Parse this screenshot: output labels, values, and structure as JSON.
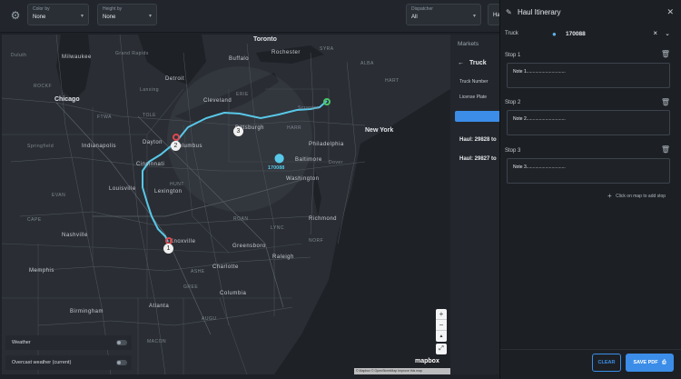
{
  "toolbar": {
    "color_by": {
      "label": "Color by",
      "value": "None"
    },
    "height_by": {
      "label": "Height by",
      "value": "None"
    },
    "dispatcher": {
      "label": "Dispatcher",
      "value": "All"
    },
    "extra_value": "Ha"
  },
  "map": {
    "labels": {
      "toronto": "Toronto",
      "chicago": "Chicago",
      "new_york": "New York",
      "milwaukee": "Milwaukee",
      "grand_rapids": "Grand Rapids",
      "detroit": "Detroit",
      "cleveland": "Cleveland",
      "pittsburgh": "Pittsburgh",
      "harrisburg": "HARR",
      "philadelphia": "Philadelphia",
      "baltimore": "Baltimore",
      "washington": "Washington",
      "columbus": "Columbus",
      "indianapolis": "Indianapolis",
      "cincinnati": "Cincinnati",
      "louisville": "Louisville",
      "lexington": "Lexington",
      "nashville": "Nashville",
      "knoxville": "Knoxville",
      "charlotte": "Charlotte",
      "greensboro": "Greensboro",
      "raleigh": "Raleigh",
      "richmond": "Richmond",
      "norfolk": "NORF",
      "atlanta": "Atlanta",
      "birmingham": "Birmingham",
      "memphis": "Memphis",
      "columbia": "Columbia",
      "rochester": "Rochester",
      "buffalo": "Buffalo",
      "syracuse": "SYRA",
      "albany": "ALBA",
      "erie": "ERIE",
      "toledo": "TOLE",
      "fort_wayne": "FTWA",
      "dayton": "Dayton",
      "springfield": "Springfield",
      "evansville": "EVAN",
      "cape": "CAPE",
      "hunt": "HUNT",
      "roan": "ROAN",
      "duluth": "Duluth",
      "lansing": "Lansing",
      "rockford": "ROCKF",
      "dover": "Dover",
      "scranton": "Scranton",
      "hartford": "HART",
      "lynchburg": "LYNC",
      "asheville": "ASHE",
      "greenville": "GREE",
      "augusta": "AUGU",
      "macon": "MACON"
    },
    "truck_marker_label": "170088",
    "stop_numbers": [
      "1",
      "2",
      "3"
    ],
    "mapbox": "mapbox",
    "attribution": "© Mapbox © OpenStreetMap Improve this map",
    "zoom_in": "+",
    "zoom_out": "−",
    "compass": "▲"
  },
  "layers": {
    "weather": "Weather",
    "overcast": "Overcast weather (current)"
  },
  "middle_panel": {
    "tab": "Markets",
    "back_label": "Truck",
    "truck_number": "Truck Number",
    "license_plate": "License Plate",
    "haul1": "Haul: 29828 to",
    "haul2": "Haul: 29827 to"
  },
  "itinerary": {
    "title": "Haul Itinerary",
    "truck_label": "Truck",
    "truck_value": "170088",
    "stops": [
      {
        "label": "Stop 1",
        "note": "Note 1..............................."
      },
      {
        "label": "Stop 2",
        "note": "Note 2..............................."
      },
      {
        "label": "Stop 3",
        "note": "Note 3..............................."
      }
    ],
    "add_stop": "Click on map to add stop",
    "clear": "CLEAR",
    "save": "SAVE PDF"
  },
  "colors": {
    "route": "#58c8e8",
    "stop_red": "#e0474c",
    "stop_green": "#4cc768",
    "accent": "#3b8de8"
  }
}
